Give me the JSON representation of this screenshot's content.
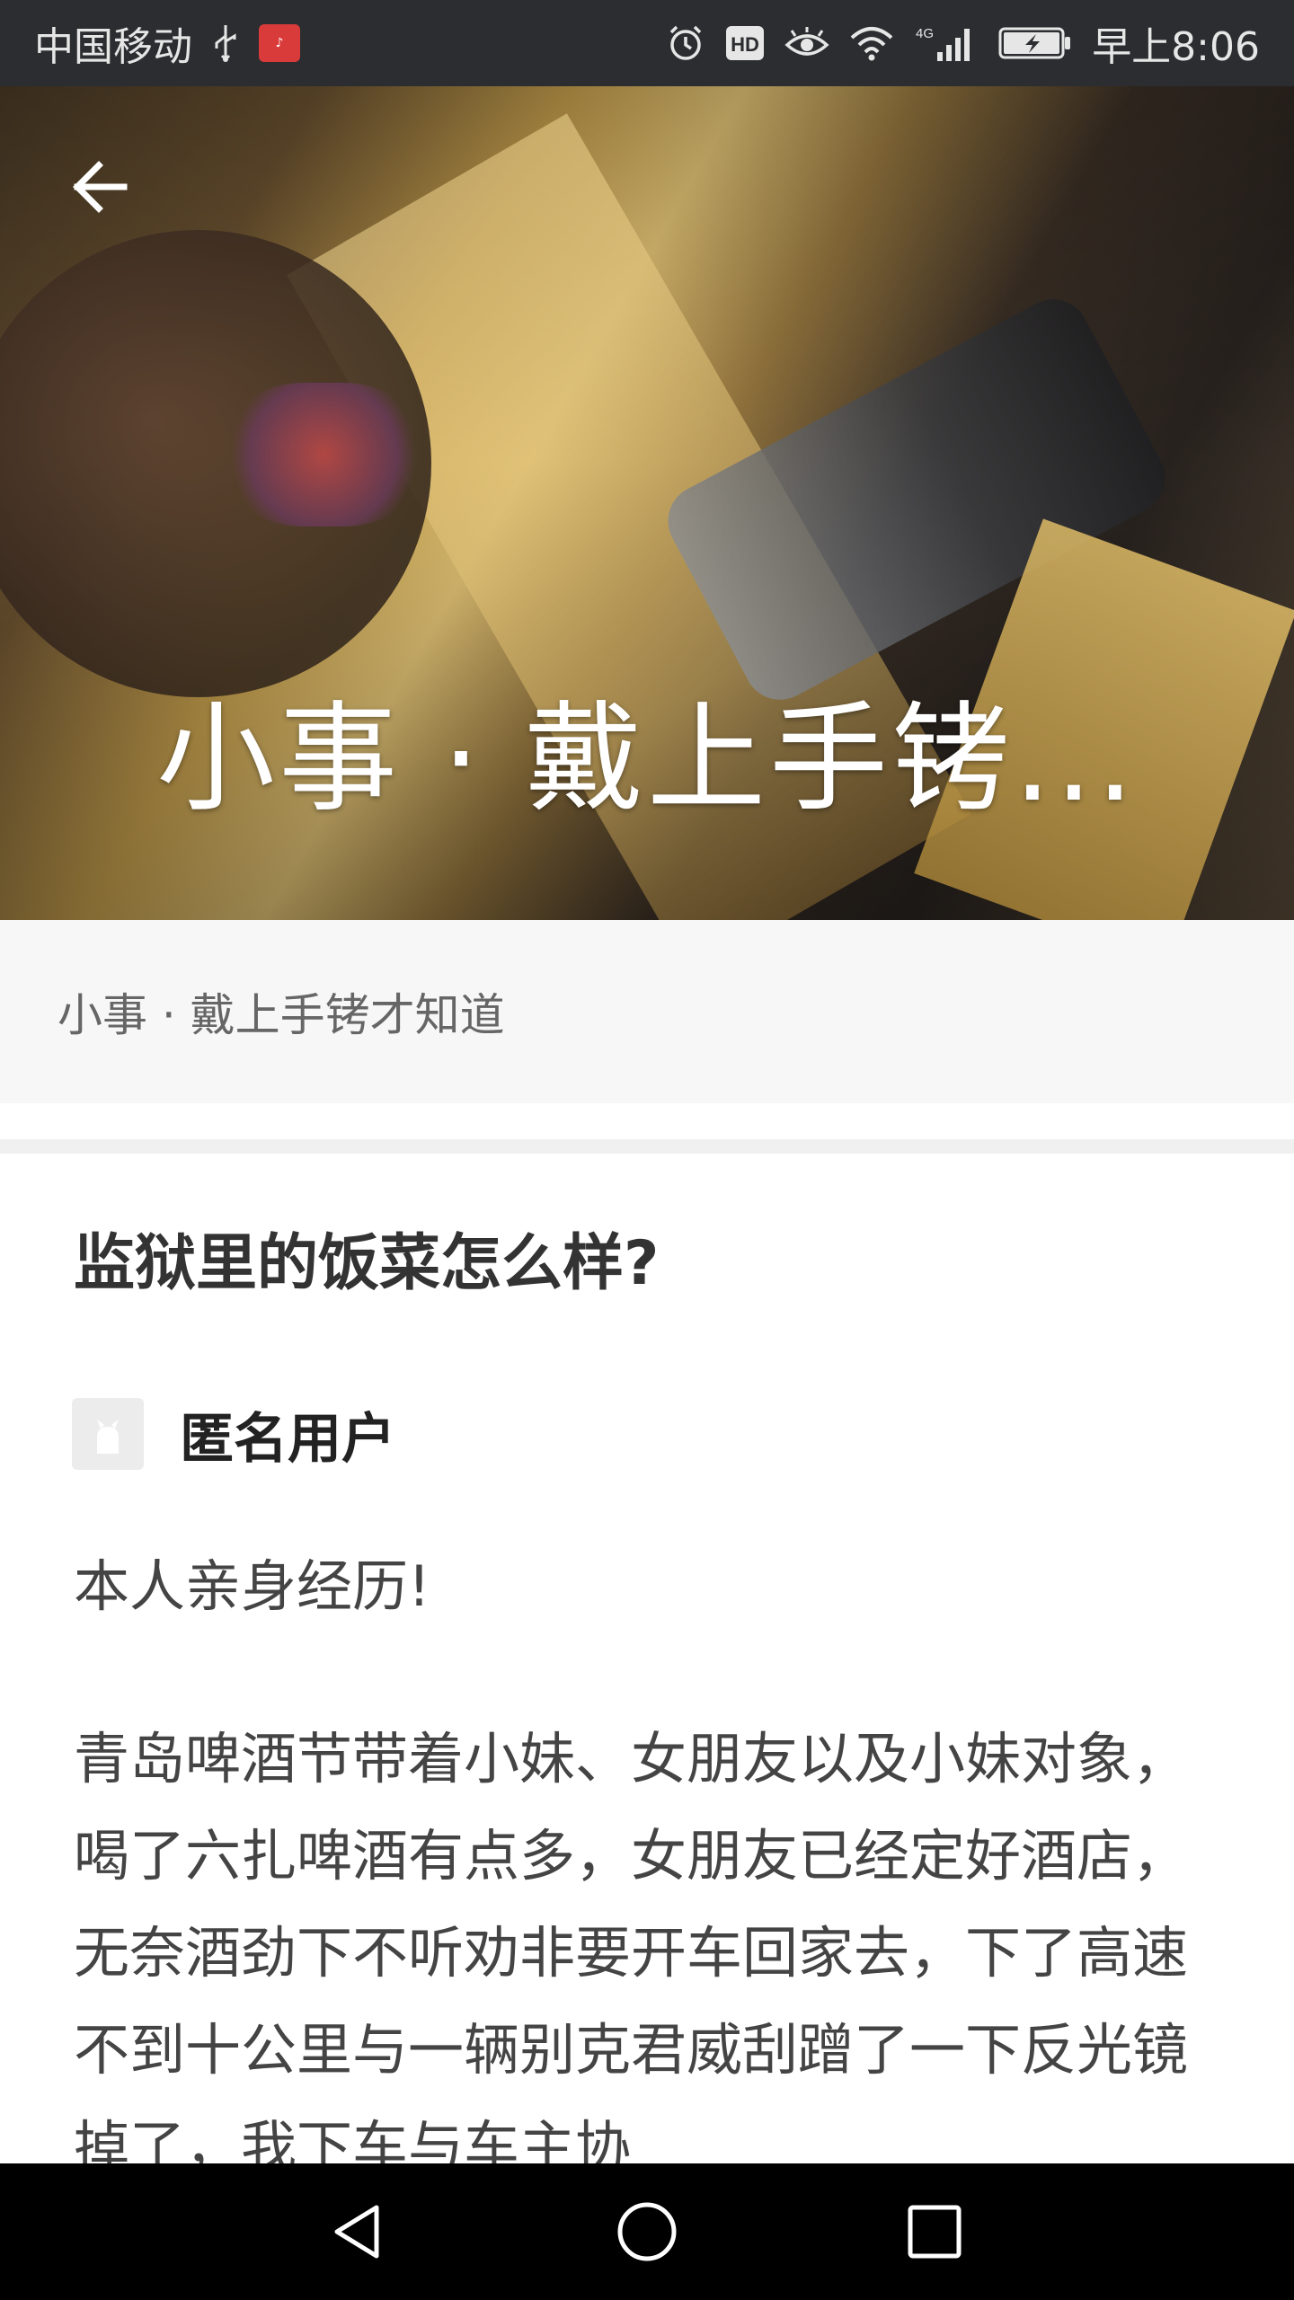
{
  "status_bar": {
    "carrier": "中国移动",
    "network_label": "4G",
    "time": "早上8:06"
  },
  "hero": {
    "title": "小事 · 戴上手铐..."
  },
  "column": {
    "name": "小事 · 戴上手铐才知道"
  },
  "article": {
    "question": "监狱里的饭菜怎么样?",
    "author": "匿名用户",
    "paragraphs": [
      "本人亲身经历!",
      "青岛啤酒节带着小妹、女朋友以及小妹对象，喝了六扎啤酒有点多，女朋友已经定好酒店，无奈酒劲下不听劝非要开车回家去，下了高速不到十公里与一辆别克君威刮蹭了一下反光镜掉了，我下车与车主协"
    ]
  },
  "colors": {
    "status_bar_bg": "#2b2d30",
    "column_bar_bg": "#f7f7f7",
    "nav_bar_bg": "#000000",
    "text_primary": "#333333"
  }
}
